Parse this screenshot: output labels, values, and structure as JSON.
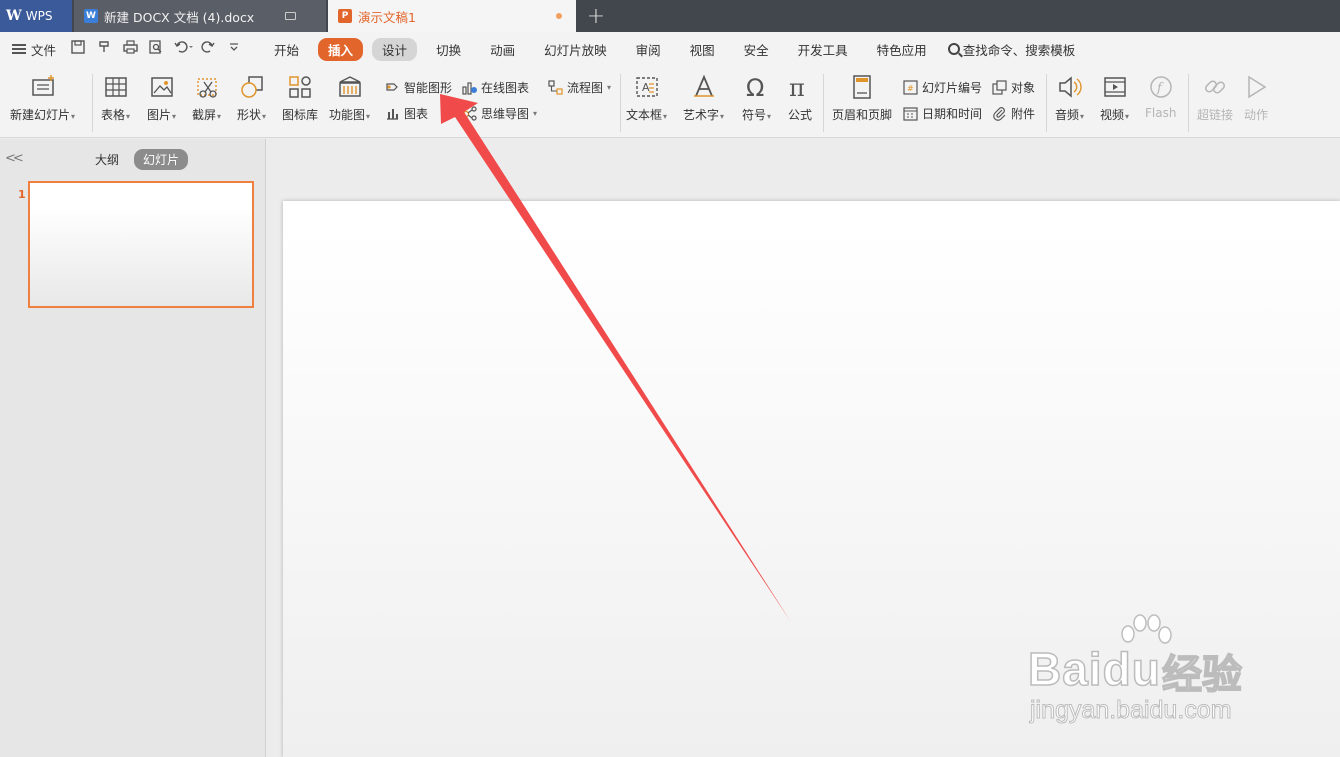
{
  "tabs": {
    "wps_label": "WPS",
    "doc_label": "新建 DOCX 文档 (4).docx",
    "ppt_label": "演示文稿1",
    "add_label": "+"
  },
  "menu": {
    "file_label": "文件",
    "items": [
      "开始",
      "插入",
      "设计",
      "切换",
      "动画",
      "幻灯片放映",
      "审阅",
      "视图",
      "安全",
      "开发工具",
      "特色应用"
    ],
    "search_label": "查找命令、搜索模板"
  },
  "ribbon": {
    "new_slide": "新建幻灯片",
    "table": "表格",
    "picture": "图片",
    "screenshot": "截屏",
    "shape": "形状",
    "icon_lib": "图标库",
    "func_chart": "功能图",
    "smart_art": "智能图形",
    "chart": "图表",
    "online_chart": "在线图表",
    "mind_map": "思维导图",
    "flowchart": "流程图",
    "textbox": "文本框",
    "wordart": "艺术字",
    "symbol": "符号",
    "formula": "公式",
    "header_footer": "页眉和页脚",
    "slide_number": "幻灯片编号",
    "date_time": "日期和时间",
    "object": "对象",
    "attachment": "附件",
    "audio": "音频",
    "video": "视频",
    "flash": "Flash",
    "hyperlink": "超链接",
    "action": "动作"
  },
  "left_panel": {
    "outline_tab": "大纲",
    "slides_tab": "幻灯片",
    "slide_number": "1",
    "collapse": "<<"
  },
  "watermark": {
    "brand": "Bai",
    "brand_suffix": "du",
    "jingyan": "经验",
    "url": "jingyan.baidu.com"
  },
  "colors": {
    "accent": "#e2652b",
    "arrow": "#f04a4a"
  }
}
